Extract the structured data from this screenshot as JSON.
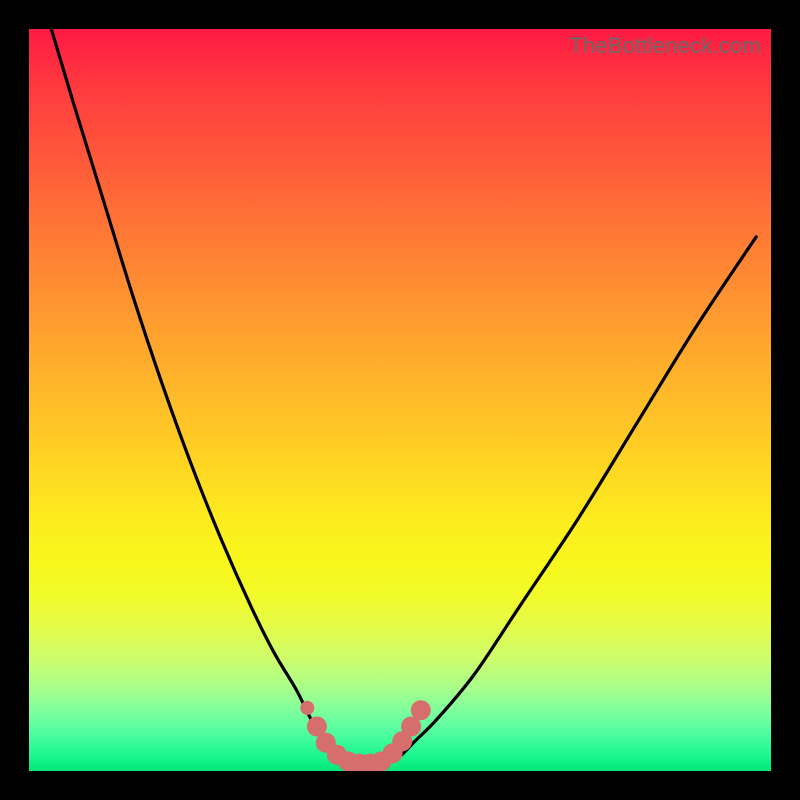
{
  "watermark": "TheBottleneck.com",
  "colors": {
    "frame": "#000000",
    "curve": "#000000",
    "marker": "#d66e6e",
    "gradient_top": "#ff1a44",
    "gradient_bottom": "#00e877"
  },
  "chart_data": {
    "type": "line",
    "title": "",
    "xlabel": "",
    "ylabel": "",
    "xlim": [
      0,
      100
    ],
    "ylim": [
      0,
      100
    ],
    "note": "Axes unlabeled; bottleneck curve with minimum near x≈42–48. Values estimated from pixel positions (y=0 at bottom, y=100 at top).",
    "series": [
      {
        "name": "bottleneck-curve",
        "x": [
          3,
          6,
          10,
          14,
          18,
          22,
          26,
          30,
          33,
          36,
          38,
          40,
          42,
          44,
          46,
          48,
          50,
          52,
          55,
          60,
          66,
          74,
          82,
          90,
          98
        ],
        "y": [
          100,
          90,
          77,
          64,
          52,
          41,
          31,
          22,
          16,
          11,
          7,
          4,
          2,
          1,
          1,
          1,
          2,
          4,
          7,
          13,
          22,
          34,
          47,
          60,
          72
        ]
      }
    ],
    "markers": {
      "name": "highlighted-region",
      "x": [
        37.5,
        38.8,
        40.0,
        41.5,
        43.0,
        44.5,
        46.0,
        47.5,
        49.0,
        50.3,
        51.5,
        52.8
      ],
      "y": [
        8.5,
        6.0,
        3.8,
        2.2,
        1.3,
        1.0,
        1.0,
        1.3,
        2.4,
        4.0,
        6.0,
        8.2
      ],
      "radius_first": 7,
      "radius_rest": 10
    }
  }
}
